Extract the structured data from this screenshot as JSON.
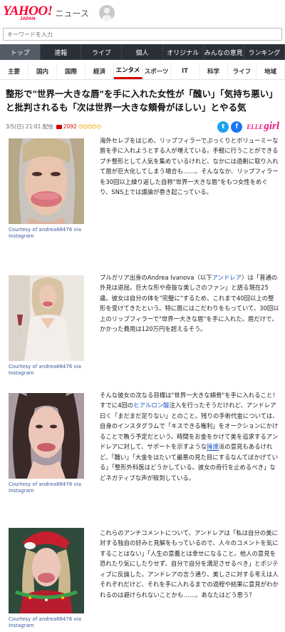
{
  "header": {
    "logo": "YAHOO!",
    "logo_sub": "JAPAN",
    "service": "ニュース"
  },
  "search": {
    "placeholder": "キーワードを入力"
  },
  "main_nav": [
    "トップ",
    "速報",
    "ライブ",
    "個人",
    "オリジナル",
    "みんなの意見",
    "ランキング"
  ],
  "sub_nav": [
    "主要",
    "国内",
    "国際",
    "経済",
    "エンタメ",
    "スポーツ",
    "IT",
    "科学",
    "ライフ",
    "地域"
  ],
  "article": {
    "title": "整形で\"世界一大きな唇\"を手に入れた女性が「醜い」「気持ち悪い」と批判されるも「次は世界一大きな頬骨がほしい」とやる気",
    "date": "3/5(日) 21:01 配信",
    "comment_count": "2092",
    "emoji": "😊😊😊😊😊",
    "source_brand_1": "ELLE",
    "source_brand_2": "girl",
    "twitter_label": "t",
    "facebook_label": "f"
  },
  "sections": [
    {
      "caption": "Courtesy of andrea88476 via Instagram",
      "text": "海外セレブをはじめ、リップフィラーでぷっくりとボリューミーな唇を手に入れようとする人が増えている。手軽に行うことができるプチ整形として人気を集めているけれど、なかには過剰に取り入れて唇が巨大化してしまう場合も……。そんななか、リップフィラーを30回以上繰り返した自称\"世界一大きな唇\"をもつ女性をめぐり、SNS上では議論が巻き起こっている。"
    },
    {
      "caption": "Courtesy of andrea88476 via Instagram",
      "text_pre": "ブルガリア出身のAndrea Ivanova（以下",
      "text_link": "アンドレア",
      "text_post": "）は「普通の外見は退屈。巨大な形や奇抜な美しさのファン」と語る現在25歳。彼女は自分の体を\"完璧に\"するため、これまで40回以上の整形を受けてきたという。特に唇にはこだわりをもっていて、30回以上のリップフィラーで\"世界一大きな唇\"を手に入れた。唇だけで、かかった費用は120万円を超えるそう。"
    },
    {
      "caption": "Courtesy of andrea88476 via Instagram",
      "text_pre": "そんな彼女の次なる目標は\"世界一大きな頬骨\"を手に入れること！　すでに4回の",
      "text_link": "ヒアルロン酸",
      "text_mid": "注入を行ったそうだけれど、アンドレア曰く「まだまだ足りない」とのこと。残りの手術代金については、自身のインスタグラムで「キスできる権利」をオークションにかけることで賄う予定だという。時間をお金をかけて美を追求するアンドレアに対して、サポートを示すような",
      "text_link2": "擁護",
      "text_post": "派の意見もあるけれど、「醜い」「大金をはたいて最悪の見た目にするなんてばかげている」「整形外科医はどうかしている。彼女の奇行を止めるべき」などネガティブな声が殺到している。"
    },
    {
      "caption": "Courtesy of andrea88476 via Instagram",
      "text": "これらのアンチコメントについて、アンドレアは「私は自分の美に対する独自の好みと見解をもっているので、人々のコメントを気にすることはない」「人生の意義とは幸せになること。他人の意見を恐れたり気にしたりせず、自分で自分を満足させるべき」とポジティブに反論した。アンドレアの言う通り、美しさに対する考えは人それぞれだけど、それを手に入れるまでの過程や結果に意見がわかれるのは避けられないことかも……。あなたはどう思う？"
    }
  ]
}
